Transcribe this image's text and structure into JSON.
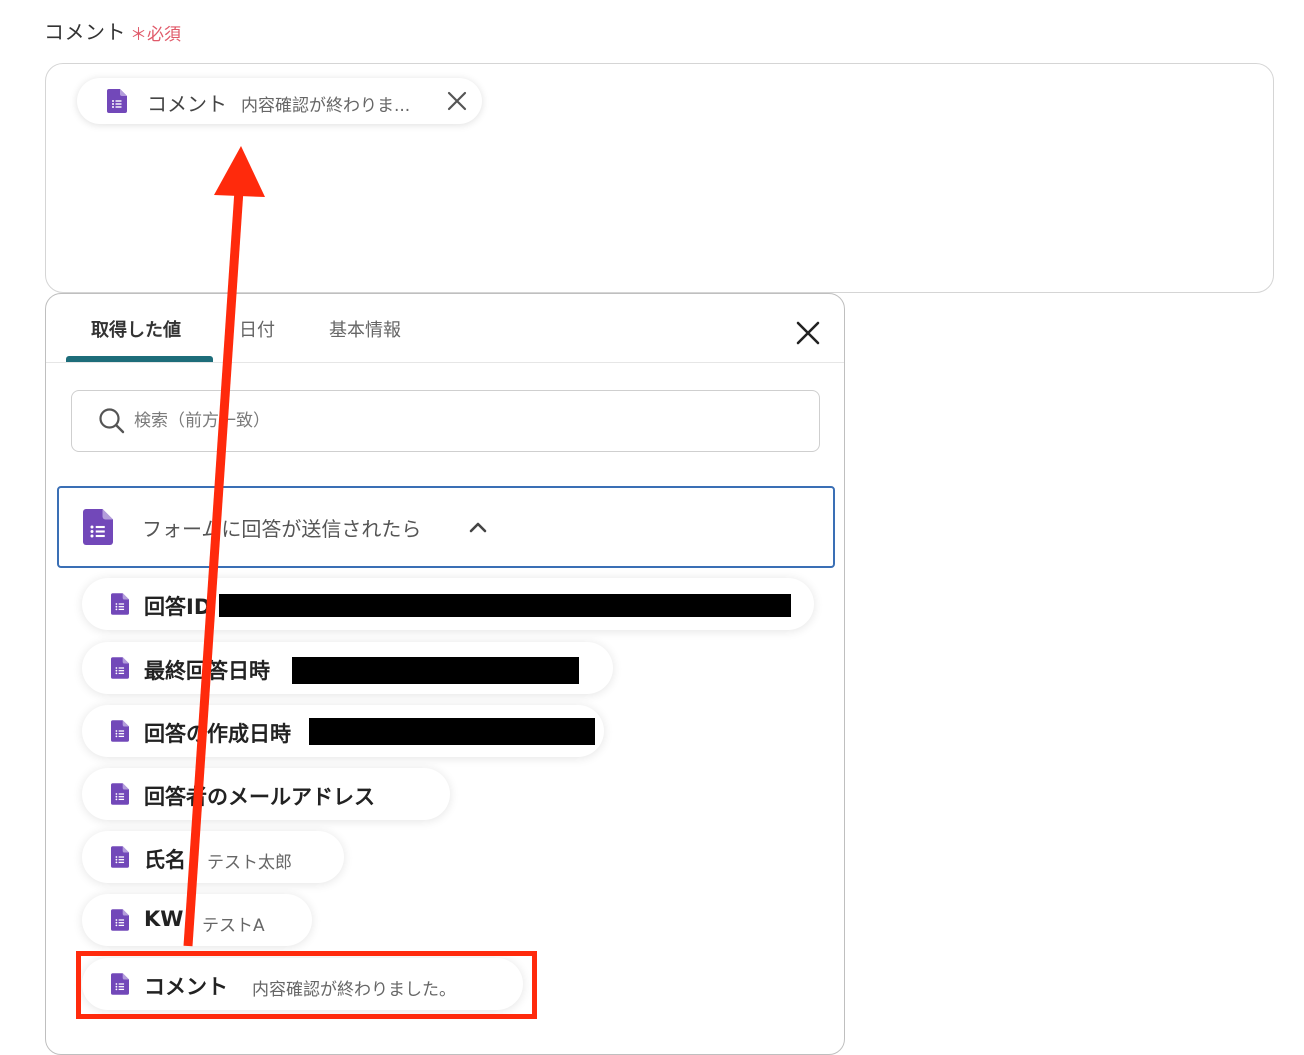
{
  "field": {
    "label": "コメント",
    "required_mark": "＊必須"
  },
  "selected_chip": {
    "label": "コメント",
    "value": "内容確認が終わりま...",
    "icon": "google-forms-icon",
    "remove_icon": "close-icon"
  },
  "panel": {
    "tabs": [
      {
        "label": "取得した値",
        "active": true
      },
      {
        "label": "日付",
        "active": false
      },
      {
        "label": "基本情報",
        "active": false
      }
    ],
    "close_icon": "close-icon",
    "search": {
      "placeholder": "検索（前方一致）",
      "value": ""
    },
    "section": {
      "title": "フォームに回答が送信されたら",
      "icon": "google-forms-icon",
      "toggle_icon": "chevron-up-icon"
    },
    "items": [
      {
        "label": "回答ID",
        "value": ""
      },
      {
        "label": "最終回答日時",
        "value": ""
      },
      {
        "label": "回答の作成日時",
        "value": ""
      },
      {
        "label": "回答者のメールアドレス",
        "value": ""
      },
      {
        "label": "氏名",
        "value": "テスト太郎"
      },
      {
        "label": "KW",
        "value": "テストA"
      },
      {
        "label": "コメント",
        "value": "内容確認が終わりました。"
      }
    ]
  },
  "colors": {
    "accent_tab": "#1d6d7a",
    "section_border": "#3a6fb5",
    "forms_purple": "#7248b9",
    "required_red": "#e05a6a",
    "annotation_red": "#ff2a0c"
  }
}
